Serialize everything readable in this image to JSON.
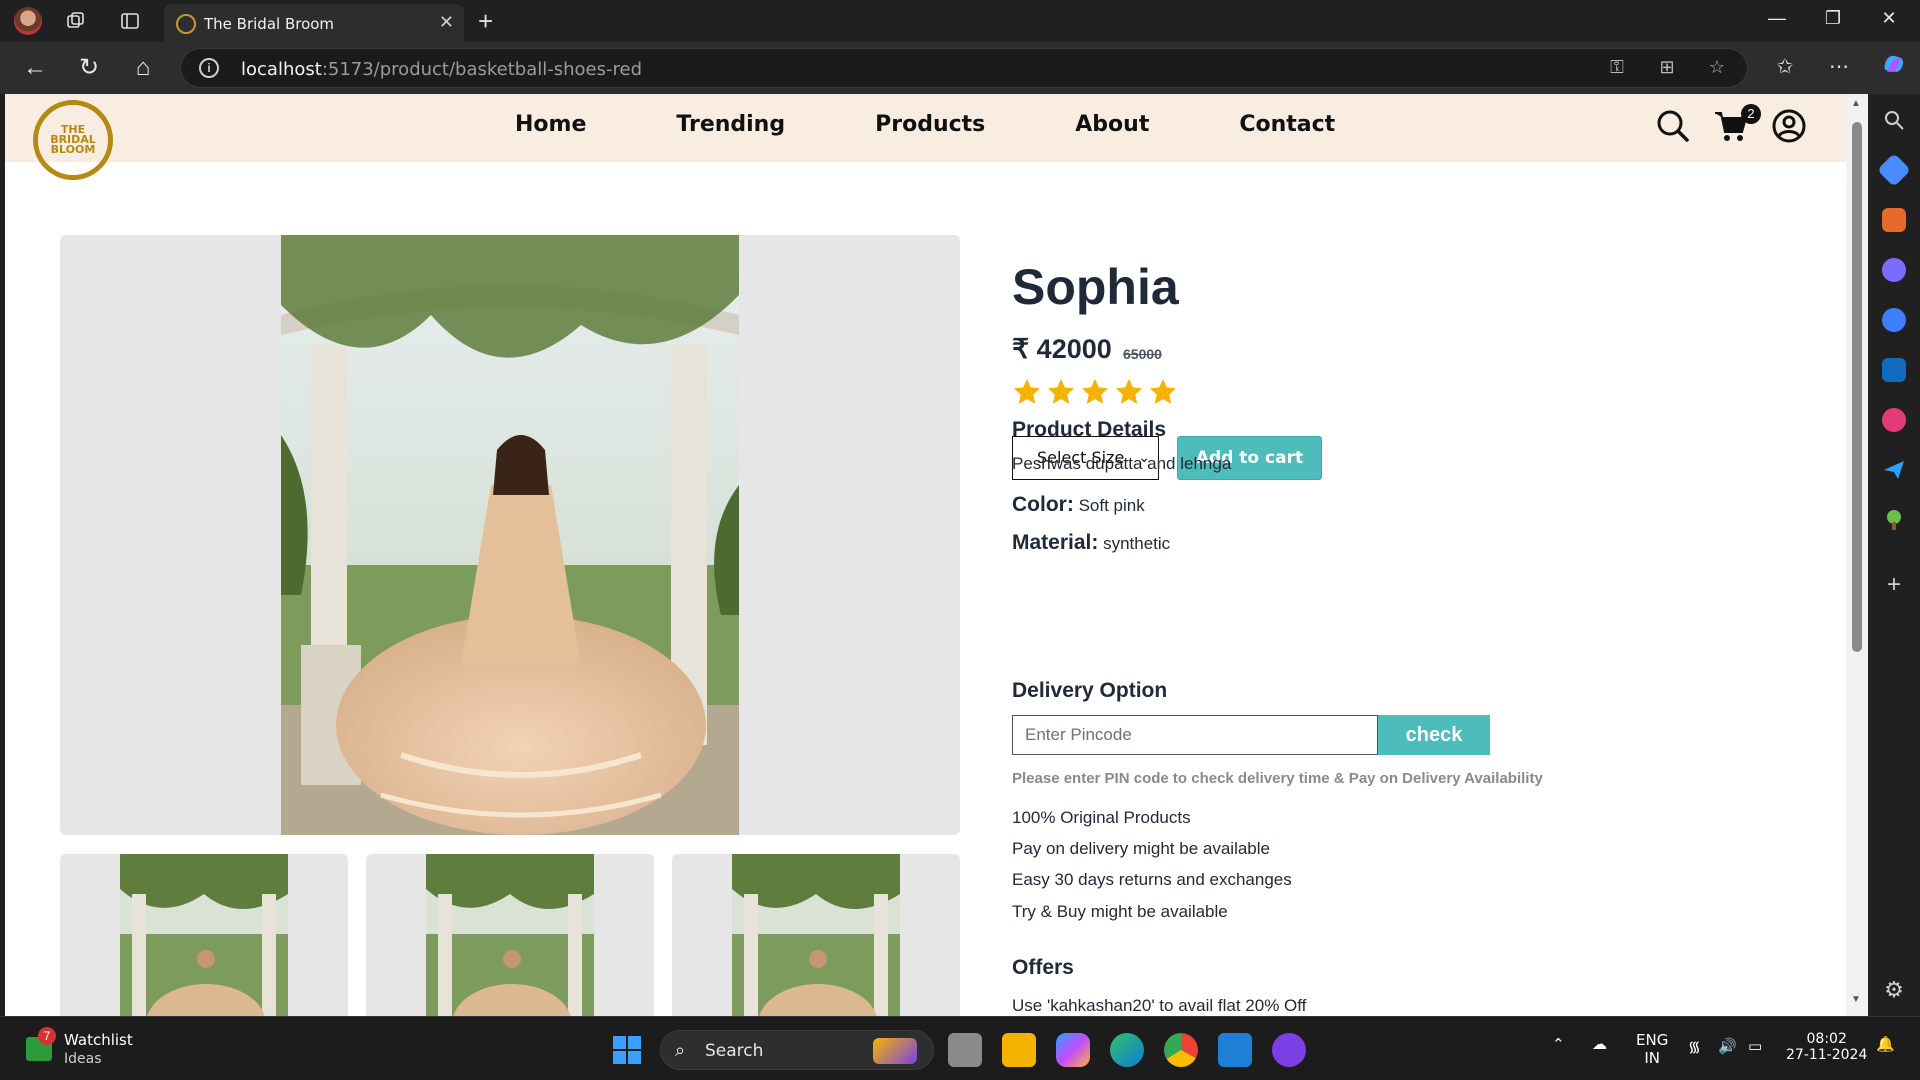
{
  "browser": {
    "tab_title": "The Bridal Broom",
    "url_host": "localhost",
    "url_path": ":5173/product/basketball-shoes-red"
  },
  "site": {
    "logo_lines": [
      "THE",
      "BRIDAL",
      "BLOOM"
    ],
    "nav": [
      "Home",
      "Trending",
      "Products",
      "About",
      "Contact"
    ],
    "cart_count": "2"
  },
  "product": {
    "title": "Sophia",
    "price": "₹ 42000",
    "mrp": "65000",
    "rating": 5,
    "size_placeholder": "Select Size",
    "add_to_cart": "Add to cart",
    "details_heading": "Product Details",
    "details_text": "Peshwas dupatta and lehnga",
    "color_label": "Color:",
    "color_value": "Soft pink",
    "material_label": "Material:",
    "material_value": "synthetic",
    "delivery_heading": "Delivery Option",
    "pin_placeholder": "Enter Pincode",
    "check_label": "check",
    "pin_note": "Please enter PIN code to check delivery time & Pay on Delivery Availability",
    "features": [
      "100% Original Products",
      "Pay on delivery might be available",
      "Easy 30 days returns and exchanges",
      "Try & Buy might be available"
    ],
    "offers_heading": "Offers",
    "offer_text": "Use 'kahkashan20' to avail flat 20% Off"
  },
  "taskbar": {
    "watchlist_title": "Watchlist",
    "watchlist_sub": "Ideas",
    "watchlist_badge": "7",
    "search_label": "Search",
    "lang_top": "ENG",
    "lang_bottom": "IN",
    "time": "08:02",
    "date": "27-11-2024"
  },
  "colors": {
    "accent_teal": "#4fbcbc",
    "header_bg": "#f9ede2",
    "logo_gold": "#b58a12",
    "star": "#f5b301"
  }
}
